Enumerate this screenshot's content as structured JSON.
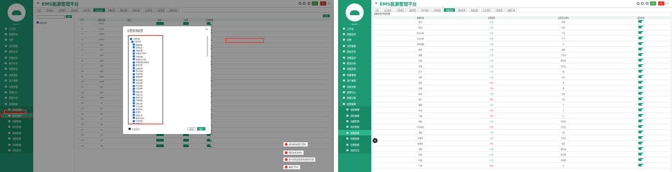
{
  "app_title": "EMS能源管理平台",
  "user_label": "admin",
  "badges": [
    "0",
    "0",
    "0",
    "0"
  ],
  "sidebar_items": [
    "工作台",
    "数据查询",
    "告警",
    "实时数据",
    "能耗分析",
    "设备监测",
    "能流分析",
    "电能质量",
    "设备管理",
    "用户管理",
    "系统设置",
    "报表中心",
    "数据字典",
    "权限管理",
    "系统管理",
    "角色管理",
    "设备配置",
    "网关配置",
    "参数配置",
    "采集配置",
    "告警配置",
    "系统日志"
  ],
  "sidebar_active_left": "角色管理",
  "sidebar_active_right": "参数配置",
  "tabs": [
    "首页",
    "实时监控",
    "告警管理",
    "设备管理",
    "用户管理",
    "角色管理",
    "参数配置",
    "网关管理",
    "系统设置",
    "日志管理",
    "告警配置",
    "数据字典"
  ],
  "left": {
    "list_items": [
      "角色管理"
    ],
    "search_btn": "搜索",
    "add_btn": "新增",
    "headers": [
      "序号",
      "角色名称",
      "备注",
      "操作",
      "权限",
      "可用状态"
    ],
    "rows": [
      "admin",
      "user1",
      "user2",
      "guest",
      "test",
      "dev",
      "vip1",
      "vip2",
      "ops",
      "mgr",
      "view",
      "audit",
      "lab",
      "pm",
      "sale",
      "cs",
      "hr",
      "fin",
      "it",
      "qa",
      "rd",
      "ui",
      "ux",
      "mk"
    ],
    "toasts": [
      "操作成功权限已更新",
      "保存失败请重试",
      "用户权限设置完成请刷新页面",
      "数据已同步"
    ]
  },
  "modal": {
    "title": "设置权限配置",
    "tree": [
      "全部权限",
      "系统首页",
      "数据看板",
      "实时监控",
      "电能质量",
      "设备运行监测",
      "告警管理",
      "能耗统计分析",
      "电能质量分析报告",
      "能流分析",
      "设备管理",
      "用户管理",
      "角色管理",
      "参数配置",
      "网关管理",
      "系统设置",
      "日志管理",
      "告警配置",
      "数据字典",
      "采集点位",
      "报表导出",
      "历史数据",
      "趋势分析",
      "对比分析",
      "能效排名",
      "碳排放",
      "用能计划",
      "峰谷平分析",
      "负荷预测",
      "需量分析",
      "变压器监测",
      "线损分析",
      "配电监测"
    ],
    "foot_text": "全选/取消",
    "cancel": "取消",
    "ok": "确定"
  },
  "right": {
    "breadcrumb": "参数配置/告警配置",
    "headers": [
      "参数名称",
      "告警类型",
      "是否显示单位",
      "是否启用"
    ],
    "rows": [
      {
        "n": "电压",
        "s": "正常",
        "u": "伏特"
      },
      {
        "n": "电流",
        "s": "正常",
        "u": "安培"
      },
      {
        "n": "有功功率",
        "s": "正常",
        "u": "千瓦"
      },
      {
        "n": "无功功率",
        "s": "正常",
        "u": "千乏"
      },
      {
        "n": "功率因数",
        "s": "正常",
        "u": "无"
      },
      {
        "n": "频率",
        "s": "正常",
        "u": "赫兹"
      },
      {
        "n": "电能",
        "s": "正常",
        "u": "千瓦时"
      },
      {
        "n": "温度",
        "s": "正常",
        "u": "摄氏度"
      },
      {
        "n": "湿度",
        "s": "正常",
        "u": "百分比"
      },
      {
        "n": "压力",
        "s": "正常",
        "u": "帕"
      },
      {
        "n": "流量",
        "s": "正常",
        "u": "立方"
      },
      {
        "n": "液位",
        "s": "异常",
        "u": "米"
      },
      {
        "n": "转速",
        "s": "异常",
        "u": "转"
      },
      {
        "n": "振动",
        "s": "正常",
        "u": "毫米"
      },
      {
        "n": "噪声",
        "s": "异常",
        "u": "分贝"
      },
      {
        "n": "烟雾",
        "s": "正常",
        "u": "无"
      },
      {
        "n": "水浸",
        "s": "异常",
        "u": "无"
      },
      {
        "n": "门磁",
        "s": "异常",
        "u": "无"
      },
      {
        "n": "谐波",
        "s": "正常",
        "u": "百分比"
      },
      {
        "n": "不平衡度",
        "s": "异常",
        "u": "百分比"
      },
      {
        "n": "需量",
        "s": "正常",
        "u": "千瓦"
      },
      {
        "n": "负载率",
        "s": "正常",
        "u": "百分比"
      },
      {
        "n": "漏电流",
        "s": "异常",
        "u": "毫安"
      },
      {
        "n": "线温",
        "s": "正常",
        "u": "摄氏度"
      },
      {
        "n": "照度",
        "s": "正常",
        "u": "勒克斯"
      },
      {
        "n": "风速",
        "s": "正常",
        "u": "米每秒"
      },
      {
        "n": "气体",
        "s": "异常",
        "u": "无"
      }
    ]
  },
  "colors": {
    "green": "#1e9a72",
    "red": "#e53935",
    "badge_green": "#4caf50",
    "badge_red": "#e53935"
  }
}
